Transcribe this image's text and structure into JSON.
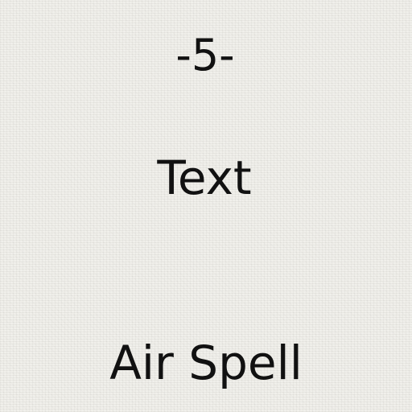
{
  "card": {
    "number_label": "-5-",
    "type_label": "Text",
    "name": "Air Spell"
  },
  "colors": {
    "background": "#efeee9",
    "text": "#111111"
  }
}
